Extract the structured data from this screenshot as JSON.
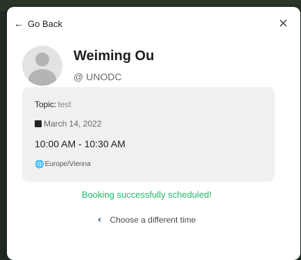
{
  "header": {
    "back_label": "Go Back",
    "close_icon": "close-icon",
    "back_icon": "arrow-left-icon"
  },
  "profile": {
    "name": "Weiming Ou",
    "org": "@ UNODC"
  },
  "booking": {
    "topic_label": "Topic:",
    "topic_value": "test",
    "date": "March 14, 2022",
    "time": "10:00 AM - 10:30 AM",
    "timezone": "Europe/Vienna"
  },
  "status": {
    "message": "Booking successfully scheduled!",
    "color": "#22b86a"
  },
  "actions": {
    "change_time_label": "Choose a different time"
  }
}
